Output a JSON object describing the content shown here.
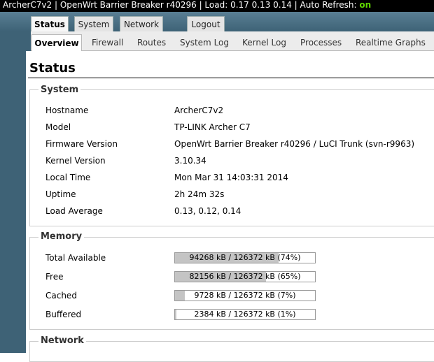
{
  "topbar": {
    "text": "ArcherC7v2 | OpenWrt Barrier Breaker r40296 | Load: 0.17 0.13 0.14 | Auto Refresh: ",
    "auto_refresh_state": "on"
  },
  "main_tabs": [
    {
      "label": "Status",
      "active": true
    },
    {
      "label": "System",
      "active": false
    },
    {
      "label": "Network",
      "active": false
    },
    {
      "label": "Logout",
      "active": false
    }
  ],
  "sub_tabs": [
    {
      "label": "Overview",
      "active": true
    },
    {
      "label": "Firewall",
      "active": false
    },
    {
      "label": "Routes",
      "active": false
    },
    {
      "label": "System Log",
      "active": false
    },
    {
      "label": "Kernel Log",
      "active": false
    },
    {
      "label": "Processes",
      "active": false
    },
    {
      "label": "Realtime Graphs",
      "active": false
    }
  ],
  "page_title": "Status",
  "system": {
    "legend": "System",
    "rows": [
      {
        "label": "Hostname",
        "value": "ArcherC7v2"
      },
      {
        "label": "Model",
        "value": "TP-LINK Archer C7"
      },
      {
        "label": "Firmware Version",
        "value": "OpenWrt Barrier Breaker r40296 / LuCI Trunk (svn-r9963)"
      },
      {
        "label": "Kernel Version",
        "value": "3.10.34"
      },
      {
        "label": "Local Time",
        "value": "Mon Mar 31 14:03:31 2014"
      },
      {
        "label": "Uptime",
        "value": "2h 24m 32s"
      },
      {
        "label": "Load Average",
        "value": "0.13, 0.12, 0.14"
      }
    ]
  },
  "memory": {
    "legend": "Memory",
    "rows": [
      {
        "label": "Total Available",
        "text": "94268 kB / 126372 kB (74%)",
        "percent": 74
      },
      {
        "label": "Free",
        "text": "82156 kB / 126372 kB (65%)",
        "percent": 65
      },
      {
        "label": "Cached",
        "text": "9728 kB / 126372 kB (7%)",
        "percent": 7
      },
      {
        "label": "Buffered",
        "text": "2384 kB / 126372 kB (1%)",
        "percent": 1
      }
    ]
  },
  "network": {
    "legend": "Network"
  },
  "colors": {
    "header_bg": "#3e6276",
    "auto_refresh_on": "#5fd700",
    "bar_fill": "#c4c4c4"
  }
}
